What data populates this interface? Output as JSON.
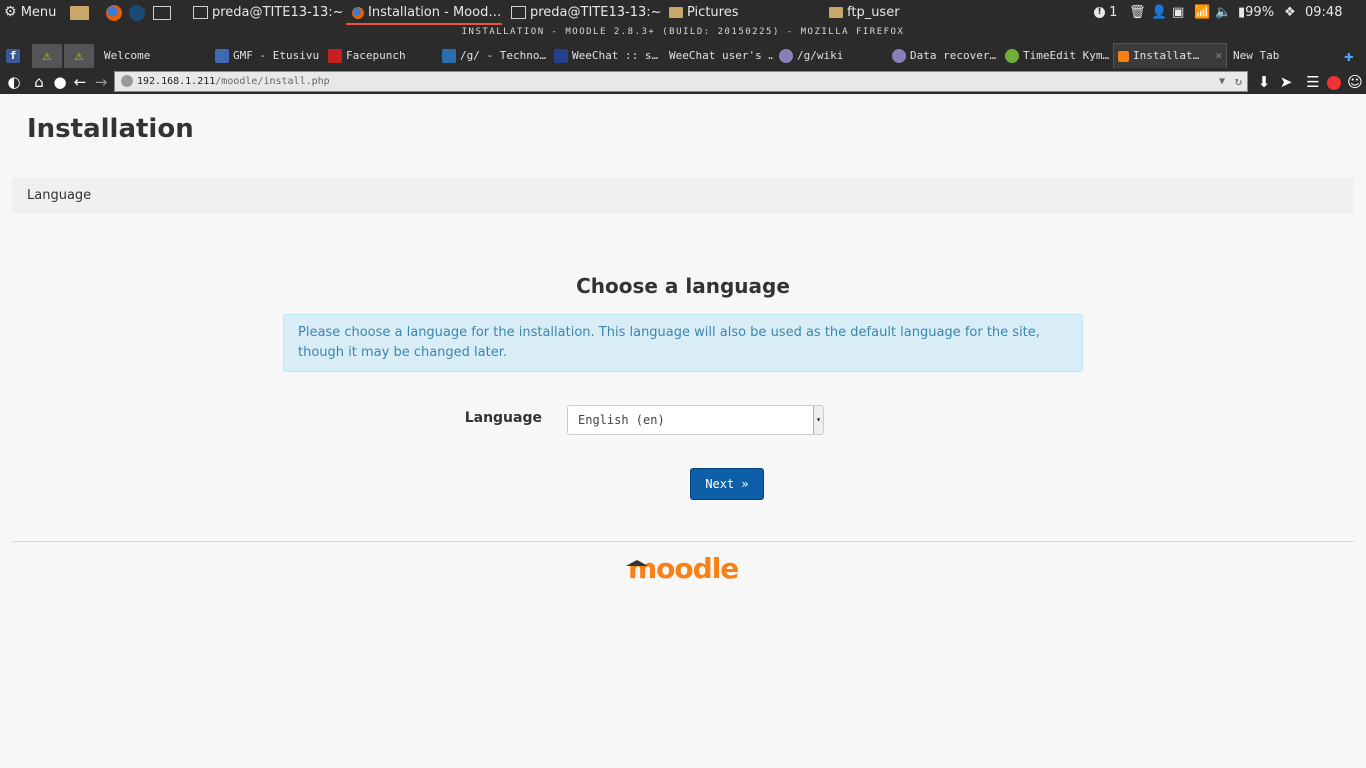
{
  "panel": {
    "menu_label": "Menu",
    "tasks": [
      "preda@TITE13-13:~",
      "Installation - Mood…",
      "preda@TITE13-13:~",
      "Pictures",
      "ftp_user"
    ],
    "notification_count": "1",
    "battery": "99%",
    "clock": "09:48"
  },
  "window_title": "INSTALLATION - MOODLE 2.8.3+ (BUILD: 20150225) - MOZILLA FIREFOX",
  "tabs": [
    "Welcome",
    "GMF - Etusivu",
    "Facepunch",
    "/g/ - Techno…",
    "WeeChat :: s…",
    "WeeChat user's …",
    "/g/wiki",
    "Data recover…",
    "TimeEdit Kym…",
    "Installat…",
    "New Tab"
  ],
  "url": {
    "host": "192.168.1.211",
    "path": "/moodle/install.php"
  },
  "page": {
    "title": "Installation",
    "breadcrumb": "Language",
    "heading": "Choose a language",
    "info": "Please choose a language for the installation. This language will also be used as the default language for the site, though it may be changed later.",
    "language_label": "Language",
    "language_value": "English (en)",
    "next_button": "Next »",
    "logo_text": "moodle"
  },
  "colors": {
    "accent": "#f98012",
    "button": "#0d5fa8",
    "info_bg": "#d9edf7",
    "info_text": "#3a87ad"
  }
}
